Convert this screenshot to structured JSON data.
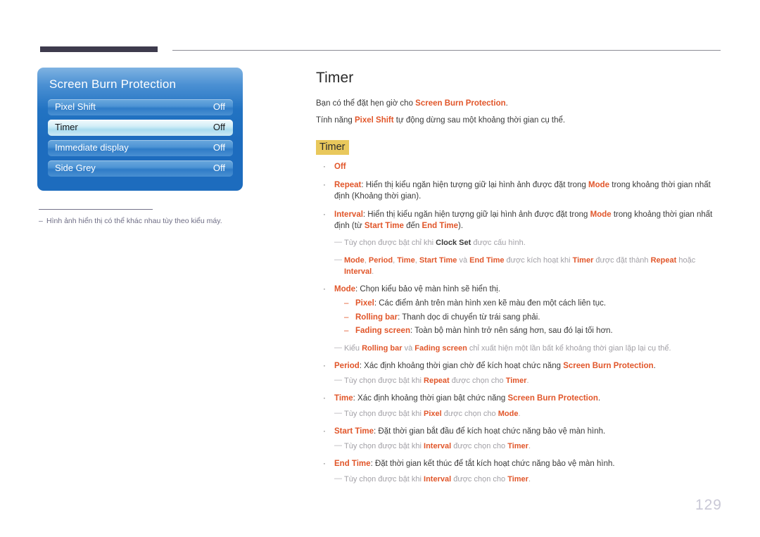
{
  "header": {
    "rule_left_color": "#3e3b4d",
    "rule_right_color": "#8d8c96"
  },
  "osd": {
    "title": "Screen Burn Protection",
    "rows": [
      {
        "label": "Pixel Shift",
        "value": "Off",
        "selected": false
      },
      {
        "label": "Timer",
        "value": "Off",
        "selected": true
      },
      {
        "label": "Immediate display",
        "value": "Off",
        "selected": false
      },
      {
        "label": "Side Grey",
        "value": "Off",
        "selected": false
      }
    ]
  },
  "figure_footnote": {
    "dash": "–",
    "text": "Hình ảnh hiển thị có thể khác nhau tùy theo kiểu máy."
  },
  "content": {
    "title": "Timer",
    "intro": [
      {
        "pre": "Bạn có thể đặt hẹn giờ cho ",
        "hl": "Screen Burn Protection",
        "post": "."
      },
      {
        "pre": "Tính năng ",
        "hl": "Pixel Shift",
        "post": " tự động dừng sau một khoảng thời gian cụ thể."
      }
    ],
    "section_chip": "Timer",
    "bullets": {
      "off": {
        "term": "Off"
      },
      "repeat": {
        "term": "Repeat",
        "t1": ": Hiển thị kiểu ngăn hiện tượng giữ lại hình ảnh được đặt trong ",
        "hl1": "Mode",
        "t2": " trong khoảng thời gian nhất định (Khoảng thời gian)."
      },
      "interval": {
        "term": "Interval",
        "t1": ": Hiển thị kiểu ngăn hiện tượng giữ lại hình ảnh được đặt trong ",
        "hl1": "Mode",
        "t2": " trong khoảng thời gian nhất định (từ ",
        "hl2": "Start Time",
        "t3": " đến ",
        "hl3": "End Time",
        "t4": ")."
      },
      "mode": {
        "term": "Mode",
        "t1": ": Chọn kiểu bảo vệ màn hình sẽ hiển thị.",
        "subs": [
          {
            "term": "Pixel",
            "text": ": Các điểm ảnh trên màn hình xen kẽ màu đen một cách liên tục."
          },
          {
            "term": "Rolling bar",
            "text": ": Thanh dọc di chuyển từ trái sang phải."
          },
          {
            "term": "Fading screen",
            "text": ": Toàn bộ màn hình trở nên sáng hơn, sau đó lại tối hơn."
          }
        ]
      },
      "period": {
        "term": "Period",
        "t1": ": Xác định khoảng thời gian chờ để kích hoạt chức năng ",
        "hl1": "Screen Burn Protection",
        "t2": "."
      },
      "time": {
        "term": "Time",
        "t1": ": Xác định khoảng thời gian bật chức năng ",
        "hl1": "Screen Burn Protection",
        "t2": "."
      },
      "start_time": {
        "term": "Start Time",
        "t1": ": Đặt thời gian bắt đầu để kích hoạt chức năng bảo vệ màn hình."
      },
      "end_time": {
        "term": "End Time",
        "t1": ": Đặt thời gian kết thúc để tắt kích hoạt chức năng bảo vệ màn hình."
      }
    },
    "notes": {
      "clock_set": {
        "t1": "Tùy chọn được bật chỉ khi ",
        "hl1": "Clock Set",
        "t2": " được cấu hình."
      },
      "activation": {
        "hl1": "Mode",
        "s1": ", ",
        "hl2": "Period",
        "s2": ", ",
        "hl3": "Time",
        "s3": ", ",
        "hl4": "Start Time",
        "s4": " và ",
        "hl5": "End Time",
        "s5": " được kích hoạt khi ",
        "hl6": "Timer",
        "s6": " được đặt thành ",
        "hl7": "Repeat",
        "s7": " hoặc ",
        "hl8": "Interval",
        "s8": "."
      },
      "rolling_fading": {
        "t1": "Kiểu ",
        "hl1": "Rolling bar",
        "t2": " và ",
        "hl2": "Fading screen",
        "t3": " chỉ xuất hiện một lần bất kể khoảng thời gian lặp lại cụ thể."
      },
      "repeat_timer": {
        "t1": "Tùy chọn được bật khi ",
        "hl1": "Repeat",
        "t2": " được chọn cho ",
        "hl2": "Timer",
        "t3": "."
      },
      "pixel_mode": {
        "t1": "Tùy chọn được bật khi ",
        "hl1": "Pixel",
        "t2": " được chọn cho ",
        "hl2": "Mode",
        "t3": "."
      },
      "interval_timer_1": {
        "t1": "Tùy chọn được bật khi ",
        "hl1": "Interval",
        "t2": " được chọn cho ",
        "hl2": "Timer",
        "t3": "."
      },
      "interval_timer_2": {
        "t1": "Tùy chọn được bật khi ",
        "hl1": "Interval",
        "t2": " được chọn cho ",
        "hl2": "Timer",
        "t3": "."
      }
    },
    "markers": {
      "bullet_dot": "·",
      "sub_dash": "–",
      "note_dash": "—"
    }
  },
  "page_number": "129",
  "colors": {
    "highlight_term": "#e1562a",
    "chip_background": "#e9c85c",
    "osd_blue": "#1d6cbe",
    "note_grey": "#a2a0a6",
    "page_number": "#c9c8d6"
  }
}
